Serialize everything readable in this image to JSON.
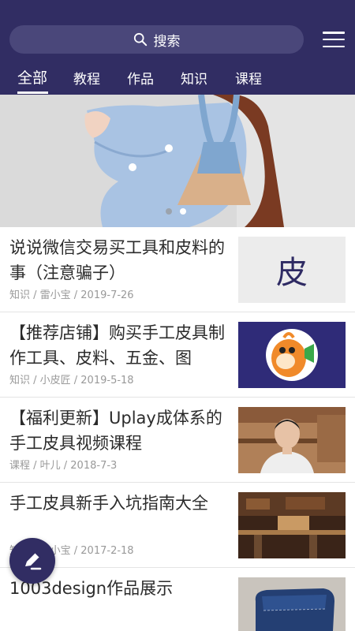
{
  "header": {
    "search_label": "搜索",
    "search_icon": "search-icon",
    "menu_icon": "hamburger-menu-icon",
    "background": "#312d63"
  },
  "tabs": [
    {
      "label": "全部",
      "active": true
    },
    {
      "label": "教程",
      "active": false
    },
    {
      "label": "作品",
      "active": false
    },
    {
      "label": "知识",
      "active": false
    },
    {
      "label": "课程",
      "active": false
    }
  ],
  "banner": {
    "slide_count": 2,
    "active_slide": 2
  },
  "articles": [
    {
      "title": "说说微信交易买工具和皮料的事（注意骗子）",
      "meta": "知识 / 雷小宝 / 2019-7-26",
      "thumb_text": "皮"
    },
    {
      "title": "【推荐店铺】购买手工皮具制作工具、皮料、五金、图",
      "meta": "知识 / 小皮匠 / 2019-5-18"
    },
    {
      "title": "【福利更新】Uplay成体系的手工皮具视频课程",
      "meta": "课程 / 叶儿 / 2018-7-3"
    },
    {
      "title": "手工皮具新手入坑指南大全",
      "meta": "知识 / 雷小宝 / 2017-2-18"
    },
    {
      "title": "1003design作品展示",
      "meta": ""
    }
  ],
  "fab": {
    "icon": "edit-pen-icon"
  }
}
